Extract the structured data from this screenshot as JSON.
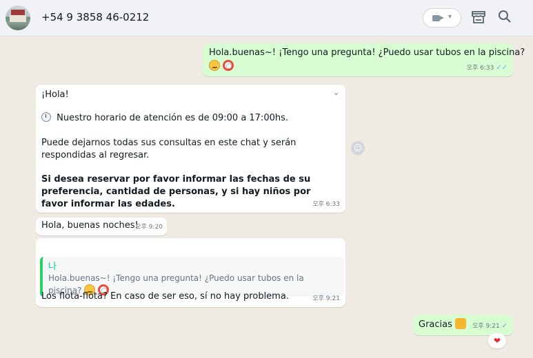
{
  "header": {
    "contact_name": "+54 9 3858 46-0212",
    "video_icon": "video-camera-icon",
    "shop_icon": "storefront-icon",
    "search_icon": "search-icon"
  },
  "messages": {
    "m1": {
      "text": "Hola.buenas~! ¡Tengo una pregunta! ¿Puedo usar tubos en la piscina?",
      "time": "오후 6:33",
      "ticks": "✓✓"
    },
    "m2": {
      "greeting": "¡Hola!",
      "hours": "Nuestro horario de atención es de 09:00 a 17:00hs.",
      "consultas": "Puede dejarnos todas sus consultas en este chat y serán respondidas al regresar.",
      "reserva": "Si desea reservar por favor informar las fechas de su preferencia, cantidad de personas, y si hay niños por favor informar las edades.",
      "time": "오후 6:33"
    },
    "m3": {
      "text": "Hola, buenas noches!",
      "time": "오후 9:20"
    },
    "m4": {
      "quote_author": "나",
      "quote_text": "Hola.buenas~! ¡Tengo una pregunta! ¿Puedo usar tubos en la piscina?",
      "text": "Los flota-flota? En caso de ser eso, sí no hay problema.",
      "time": "오후 9:21"
    },
    "m5": {
      "text": "Gracias",
      "time": "오후 9:21",
      "ticks": "✓",
      "reaction": "❤"
    }
  }
}
